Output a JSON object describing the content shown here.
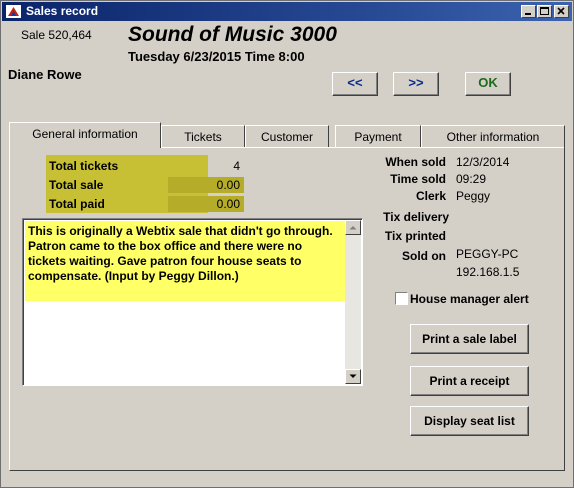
{
  "window": {
    "title": "Sales record"
  },
  "header": {
    "sale_number": "Sale 520,464",
    "show_title": "Sound of Music 3000",
    "show_datetime": "Tuesday 6/23/2015  Time 8:00",
    "patron": "Diane Rowe"
  },
  "nav": {
    "prev_label": "<<",
    "next_label": ">>",
    "ok_label": "OK"
  },
  "tabs": [
    {
      "label": "General information",
      "active": true
    },
    {
      "label": "Tickets"
    },
    {
      "label": "Customer"
    },
    {
      "label": "Payment"
    },
    {
      "label": "Other information"
    }
  ],
  "summary": {
    "total_tickets_label": "Total tickets",
    "total_tickets": "4",
    "total_sale_label": "Total sale",
    "total_sale": "0.00",
    "total_paid_label": "Total paid",
    "total_paid": "0.00"
  },
  "notes": "This is originally a Webtix sale that didn't go through. Patron came to the box office and there were no tickets waiting. Gave patron four house seats to compensate. (Input by Peggy Dillon.)",
  "info": {
    "when_sold_label": "When sold",
    "when_sold": "12/3/2014",
    "time_sold_label": "Time sold",
    "time_sold": "09:29",
    "clerk_label": "Clerk",
    "clerk": "Peggy",
    "tix_delivery_label": "Tix delivery",
    "tix_printed_label": "Tix printed",
    "sold_on_label": "Sold on",
    "sold_on_host": "PEGGY-PC",
    "sold_on_ip": "192.168.1.5"
  },
  "house_manager_alert": {
    "label": "House manager alert",
    "checked": false
  },
  "buttons": {
    "print_label": "Print a sale label",
    "print_receipt": "Print a receipt",
    "display_seats": "Display seat list"
  },
  "colors": {
    "title_bar": "#0a246a",
    "note_highlight": "#ffff66",
    "summary_box": "#c8c034"
  }
}
